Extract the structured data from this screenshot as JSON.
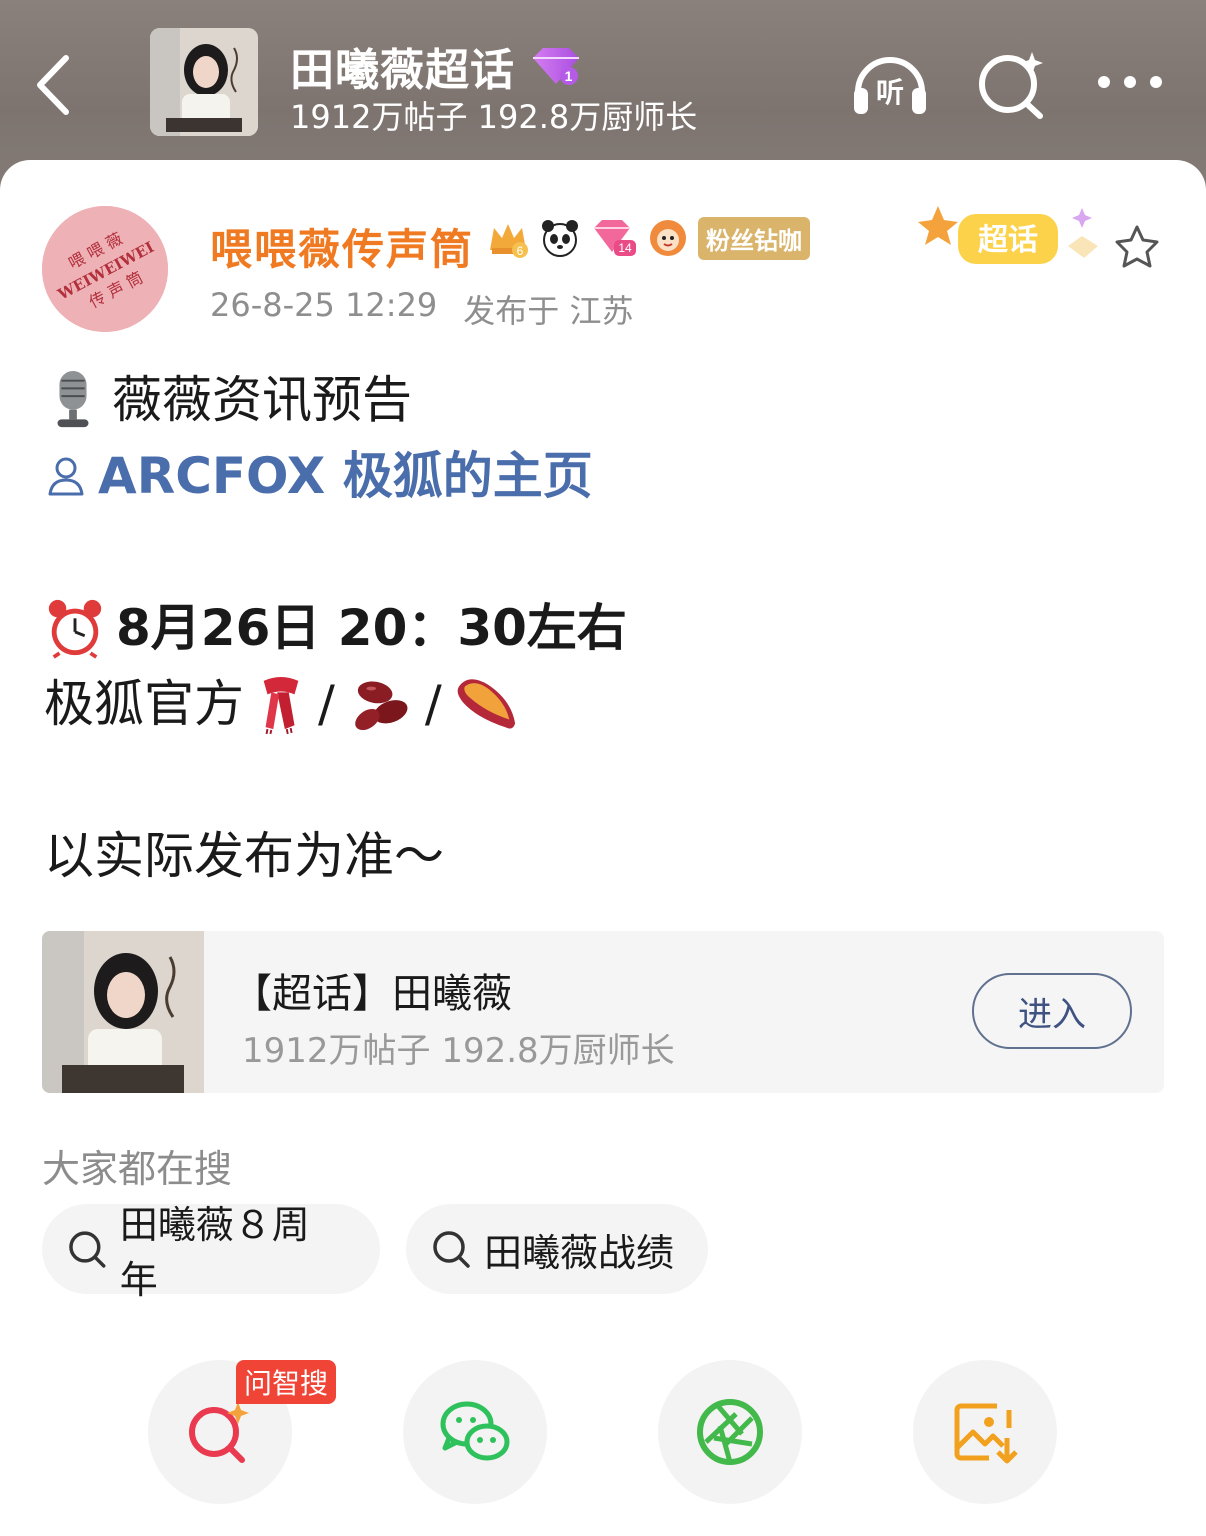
{
  "header": {
    "title": "田曦薇超话",
    "subtitle": "1912万帖子 192.8万厨师长",
    "listen_label": "听",
    "level_badge": "1",
    "background_color": "#857c78"
  },
  "post": {
    "author": {
      "name": "喂喂薇传声筒",
      "avatar_text_top": "喂 喂 薇",
      "avatar_text_mid": "WEIWEIWEI",
      "avatar_text_bottom": "传 声 筒",
      "badges": {
        "crown_level": "6",
        "diamond_level": "14",
        "fan_badge": "粉丝钻咖"
      }
    },
    "timestamp": "26-8-25 12:29",
    "location": "发布于 江苏",
    "sticker_label": "超话",
    "lines": {
      "headline": "薇薇资讯预告",
      "mention": "ARCFOX 极狐的主页",
      "time": "8月26日 20：30左右",
      "official": "极狐官方",
      "sep1": "/",
      "sep2": "/",
      "note": "以实际发布为准～"
    },
    "icons": [
      "microphone-icon",
      "person-icon",
      "alarm-clock-icon",
      "scarf-icon",
      "beans-icon",
      "sweet-potato-icon"
    ]
  },
  "topic_card": {
    "title": "【超话】田曦薇",
    "subtitle": "1912万帖子 192.8万厨师长",
    "enter_label": "进入"
  },
  "search": {
    "label": "大家都在搜",
    "chips": [
      "田曦薇８周年",
      "田曦薇战绩"
    ]
  },
  "actions": {
    "ai_search_badge": "问智搜",
    "items": [
      "ai-search-icon",
      "wechat-icon",
      "moments-icon",
      "save-image-icon"
    ]
  },
  "colors": {
    "username": "#f07a22",
    "mention": "#4a6dab",
    "enter_border": "#60708f",
    "ai_badge": "#f04437"
  }
}
